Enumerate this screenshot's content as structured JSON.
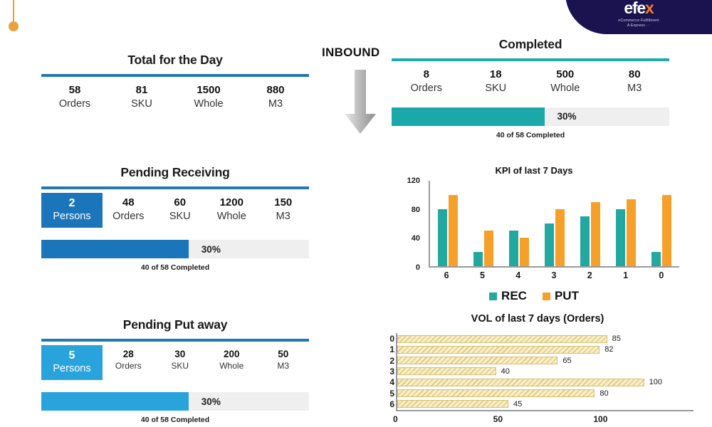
{
  "brand": {
    "logo_word_main": "efe",
    "logo_word_accent": "x",
    "tagline_line1": "eCommerce Fulfillment",
    "tagline_line2": "A Express",
    "tagline_dash": "- -",
    "navy": "#1b1250",
    "orange": "#f07f23"
  },
  "colors": {
    "blue_dark": "#1b75ba",
    "blue_light": "#29a3dc",
    "teal": "#1aa8a8",
    "rule_blue": "#2079b5",
    "rule_teal": "#1fabaa",
    "track_gray": "#efefef",
    "chart_rec": "#23a8a0",
    "chart_put": "#f6a02a",
    "chart_vol": "#f7eec7"
  },
  "inbound": {
    "label": "INBOUND",
    "arrow_icon": "down-arrow-icon"
  },
  "total_for_day": {
    "title": "Total for the Day",
    "stats": [
      {
        "value": "58",
        "label": "Orders"
      },
      {
        "value": "81",
        "label": "SKU"
      },
      {
        "value": "1500",
        "label": "Whole"
      },
      {
        "value": "880",
        "label": "M3"
      }
    ]
  },
  "pending_receiving": {
    "title": "Pending Receiving",
    "persons": {
      "value": "2",
      "label": "Persons"
    },
    "stats": [
      {
        "value": "48",
        "label": "Orders"
      },
      {
        "value": "60",
        "label": "SKU"
      },
      {
        "value": "1200",
        "label": "Whole"
      },
      {
        "value": "150",
        "label": "M3"
      }
    ],
    "progress": {
      "percent_label": "30%",
      "fill_width": "55%",
      "note": "40 of 58 Completed"
    }
  },
  "pending_put_away": {
    "title": "Pending Put away",
    "persons": {
      "value": "5",
      "label": "Persons"
    },
    "stats": [
      {
        "value": "28",
        "label": "Orders"
      },
      {
        "value": "30",
        "label": "SKU"
      },
      {
        "value": "200",
        "label": "Whole"
      },
      {
        "value": "50",
        "label": "M3"
      }
    ],
    "progress": {
      "percent_label": "30%",
      "fill_width": "55%",
      "note": "40 of 58 Completed"
    }
  },
  "completed": {
    "title": "Completed",
    "stats": [
      {
        "value": "8",
        "label": "Orders"
      },
      {
        "value": "18",
        "label": "SKU"
      },
      {
        "value": "500",
        "label": "Whole"
      },
      {
        "value": "80",
        "label": "M3"
      }
    ],
    "progress": {
      "percent_label": "30%",
      "fill_width": "55%",
      "note": "40 of 58 Completed"
    }
  },
  "chart_data": [
    {
      "type": "bar",
      "title": "KPI of last 7 Days",
      "orientation": "vertical",
      "categories": [
        "6",
        "5",
        "4",
        "3",
        "2",
        "1",
        "0"
      ],
      "series": [
        {
          "name": "REC",
          "color": "#23a8a0",
          "values": [
            80,
            20,
            50,
            60,
            70,
            80,
            20
          ]
        },
        {
          "name": "PUT",
          "color": "#f6a02a",
          "values": [
            100,
            50,
            40,
            80,
            90,
            94,
            100
          ]
        }
      ],
      "xlabel": "",
      "ylabel": "",
      "ylim": [
        0,
        120
      ],
      "yticks": [
        120,
        80,
        40,
        0
      ],
      "grid": false,
      "legend": "bottom-center"
    },
    {
      "type": "bar",
      "title": "VOL of last 7 days (Orders)",
      "orientation": "horizontal",
      "categories": [
        "0",
        "1",
        "2",
        "3",
        "4",
        "5",
        "6"
      ],
      "values": [
        85,
        82,
        65,
        40,
        100,
        80,
        45
      ],
      "data_labels": [
        "85",
        "82",
        "65",
        "40",
        "100",
        "80",
        "45"
      ],
      "xlabel": "",
      "ylabel": "",
      "xlim": [
        0,
        120
      ],
      "xticks": [
        "0",
        "50",
        "100"
      ],
      "grid": false,
      "legend": "none"
    }
  ]
}
